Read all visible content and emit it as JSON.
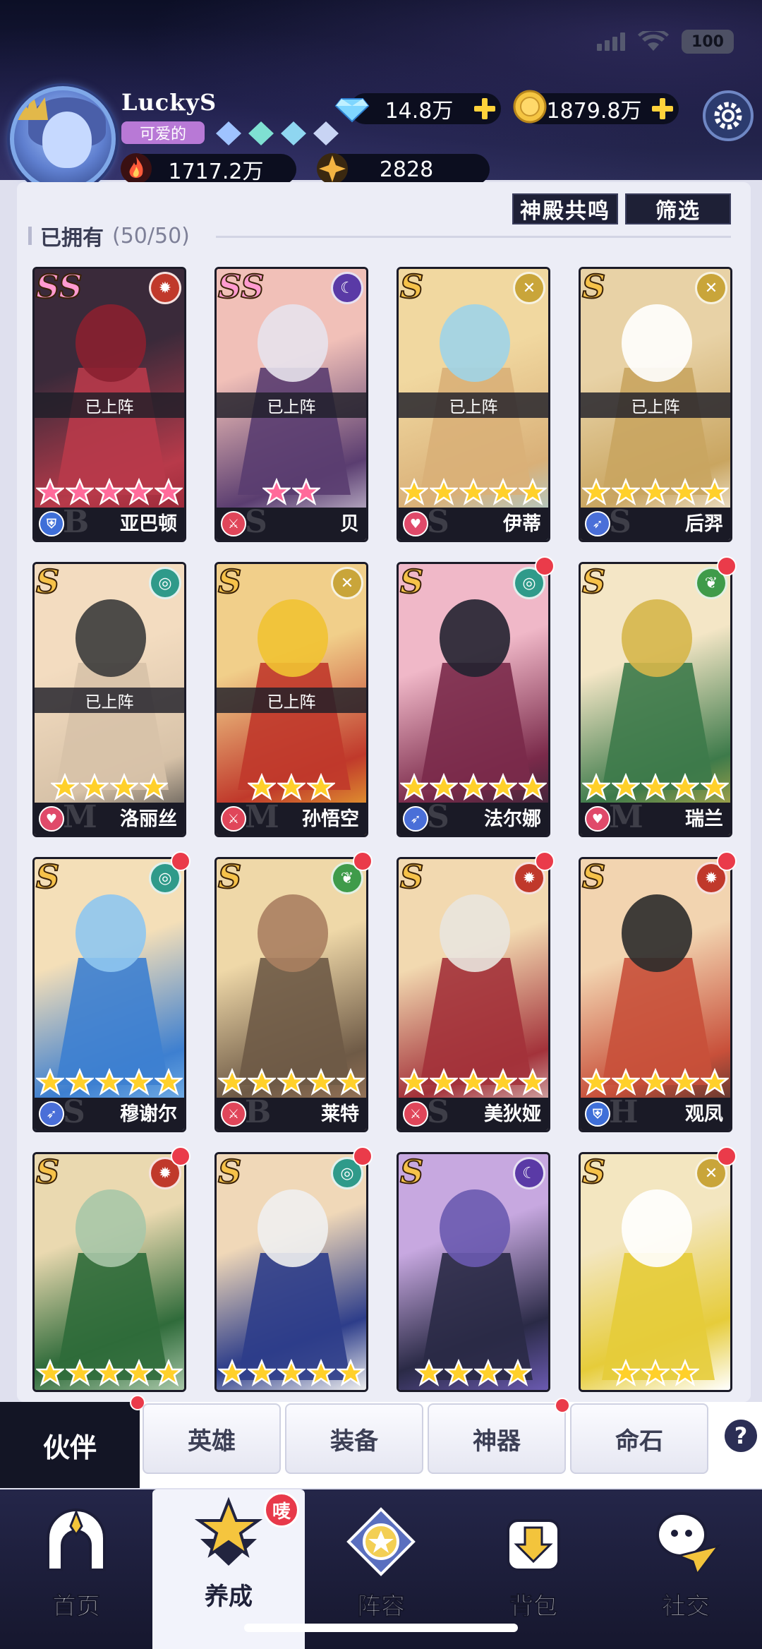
{
  "status_bar": {
    "battery": "100"
  },
  "player": {
    "name": "LuckyS",
    "title": "可爱的",
    "power": "1717.2万",
    "energy": "2828"
  },
  "currencies": {
    "diamonds": "14.8万",
    "gold": "1879.8万"
  },
  "buttons": {
    "temple_resonance": "神殿共鸣",
    "filter": "筛选"
  },
  "owned": {
    "label": "已拥有",
    "count": "(50/50)"
  },
  "deployed_label": "已上阵",
  "heroes": [
    {
      "rank": "SS",
      "name": "亚巴顿",
      "stars": 5,
      "deployed": true,
      "element": "fire",
      "role": "shield",
      "letter": "B",
      "colors": [
        "#3a2a3a",
        "#b83a4a",
        "#8a2030"
      ],
      "dot": false
    },
    {
      "rank": "SS",
      "name": "贝",
      "stars": 2,
      "deployed": true,
      "element": "moon",
      "role": "sword",
      "letter": "S",
      "colors": [
        "#f1c0b8",
        "#5a3d70",
        "#e7e2ec"
      ],
      "dot": false
    },
    {
      "rank": "S",
      "name": "伊蒂",
      "stars": 5,
      "deployed": true,
      "element": "holy",
      "role": "heart",
      "letter": "S",
      "colors": [
        "#f1d8a0",
        "#d9b078",
        "#9fd4e8"
      ],
      "dot": false
    },
    {
      "rank": "S",
      "name": "后羿",
      "stars": 5,
      "deployed": true,
      "element": "holy",
      "role": "bow",
      "letter": "S",
      "colors": [
        "#e8d2a6",
        "#c9a560",
        "#ffffff"
      ],
      "dot": false
    },
    {
      "rank": "S",
      "name": "洛丽丝",
      "stars": 4,
      "deployed": true,
      "element": "wind",
      "role": "heart",
      "letter": "M",
      "colors": [
        "#f3dcc0",
        "#d7c2a8",
        "#3b3b3b"
      ],
      "dot": false
    },
    {
      "rank": "S",
      "name": "孙悟空",
      "stars": 3,
      "deployed": true,
      "element": "holy",
      "role": "sword",
      "letter": "M",
      "colors": [
        "#f1cf8a",
        "#c0392b",
        "#f1c232"
      ],
      "dot": false
    },
    {
      "rank": "S",
      "name": "法尔娜",
      "stars": 5,
      "deployed": false,
      "element": "wind",
      "role": "bow",
      "letter": "S",
      "colors": [
        "#f0b8c8",
        "#7a2a4a",
        "#222230"
      ],
      "dot": true
    },
    {
      "rank": "S",
      "name": "瑞兰",
      "stars": 5,
      "deployed": false,
      "element": "nature",
      "role": "heart",
      "letter": "M",
      "colors": [
        "#f4e6c6",
        "#3d7a4a",
        "#d6b64a"
      ],
      "dot": true
    },
    {
      "rank": "S",
      "name": "穆谢尔",
      "stars": 5,
      "deployed": false,
      "element": "wind",
      "role": "bow",
      "letter": "S",
      "colors": [
        "#f4dfb8",
        "#3d7fd0",
        "#8fc6f0"
      ],
      "dot": true
    },
    {
      "rank": "S",
      "name": "莱特",
      "stars": 5,
      "deployed": false,
      "element": "nature",
      "role": "sword",
      "letter": "B",
      "colors": [
        "#efd8a8",
        "#6e5a46",
        "#aa8060"
      ],
      "dot": true
    },
    {
      "rank": "S",
      "name": "美狄娅",
      "stars": 5,
      "deployed": false,
      "element": "fire",
      "role": "sword",
      "letter": "S",
      "colors": [
        "#f2d9b0",
        "#a3323a",
        "#e9e4de"
      ],
      "dot": true
    },
    {
      "rank": "S",
      "name": "观凤",
      "stars": 5,
      "deployed": false,
      "element": "fire",
      "role": "shield",
      "letter": "H",
      "colors": [
        "#f2d4b0",
        "#c8503a",
        "#2b2b2b"
      ],
      "dot": true
    },
    {
      "rank": "S",
      "name": "",
      "stars": 5,
      "deployed": false,
      "element": "fire",
      "role": "",
      "letter": "",
      "colors": [
        "#ead9b0",
        "#2f6b3a",
        "#a8c7a8"
      ],
      "dot": true
    },
    {
      "rank": "S",
      "name": "",
      "stars": 5,
      "deployed": false,
      "element": "wind",
      "role": "",
      "letter": "",
      "colors": [
        "#f0d8b8",
        "#2d3d8a",
        "#efefef"
      ],
      "dot": true
    },
    {
      "rank": "S",
      "name": "",
      "stars": 4,
      "deployed": false,
      "element": "moon",
      "role": "",
      "letter": "",
      "colors": [
        "#c7a8e0",
        "#2a2a46",
        "#6a5ab0"
      ],
      "dot": false
    },
    {
      "rank": "S",
      "name": "",
      "stars": 3,
      "deployed": false,
      "element": "holy",
      "role": "",
      "letter": "",
      "colors": [
        "#f3e6c0",
        "#e6cc3a",
        "#ffffff"
      ],
      "dot": true
    }
  ],
  "subtabs": [
    {
      "label": "伙伴",
      "active": true,
      "dot": true
    },
    {
      "label": "英雄",
      "active": false,
      "dot": false
    },
    {
      "label": "装备",
      "active": false,
      "dot": false
    },
    {
      "label": "神器",
      "active": false,
      "dot": true
    },
    {
      "label": "命石",
      "active": false,
      "dot": false
    }
  ],
  "help_label": "?",
  "nav": [
    {
      "label": "首页",
      "icon": "temple-icon",
      "active": false
    },
    {
      "label": "养成",
      "icon": "upgrade-star-icon",
      "active": true,
      "badge": "唛"
    },
    {
      "label": "阵容",
      "icon": "formation-icon",
      "active": false
    },
    {
      "label": "背包",
      "icon": "backpack-icon",
      "active": false
    },
    {
      "label": "社交",
      "icon": "social-icon",
      "active": false
    }
  ],
  "colors": {
    "element_fire": "#c0392b",
    "element_moon": "#5a3aa6",
    "element_holy": "#c9a53a",
    "element_wind": "#2f9a8a",
    "element_nature": "#3f9b4a",
    "role_shield": "#3f6fd8",
    "role_sword": "#e0465a",
    "role_heart": "#e04a6a",
    "role_bow": "#4a6fd8",
    "star": "#ffd02a"
  }
}
